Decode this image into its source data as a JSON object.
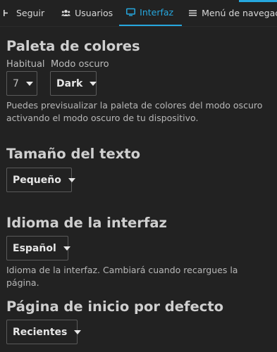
{
  "tabs": [
    {
      "label": "Seguir",
      "icon": "partial-icon"
    },
    {
      "label": "Usuarios",
      "icon": "users-icon"
    },
    {
      "label": "Interfaz",
      "icon": "monitor-icon",
      "active": true
    },
    {
      "label": "Menú de navegació",
      "icon": "menu-icon"
    }
  ],
  "sections": {
    "palette": {
      "title": "Paleta de colores",
      "regular_label": "Habitual",
      "regular_value": "7",
      "dark_label": "Modo oscuro",
      "dark_value": "Dark",
      "help": "Puedes previsualizar la paleta de colores del modo oscuro activando el modo oscuro de tu dispositivo."
    },
    "text_size": {
      "title": "Tamaño del texto",
      "value": "Pequeño"
    },
    "language": {
      "title": "Idioma de la interfaz",
      "value": "Español",
      "help": "Idioma de la interfaz. Cambiará cuando recargues la página."
    },
    "homepage": {
      "title": "Página de inicio por defecto",
      "value": "Recientes"
    }
  },
  "colors": {
    "accent": "#26a7de",
    "background": "#222222"
  }
}
